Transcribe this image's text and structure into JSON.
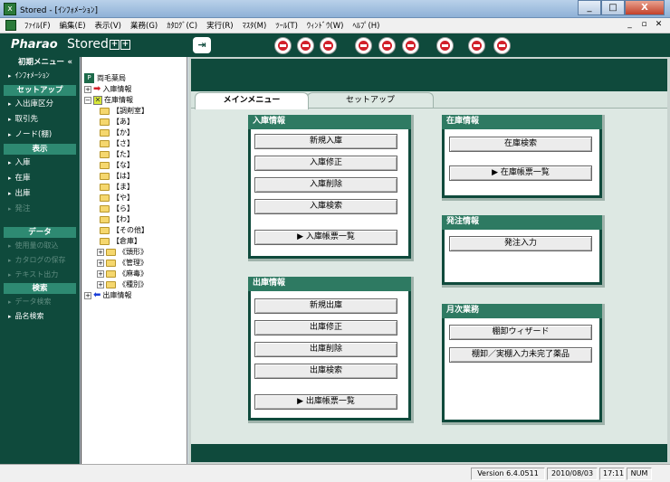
{
  "window": {
    "title": "Stored - [ｲﾝﾌｫﾒｰｼｮﾝ]",
    "min": "_",
    "max": "□",
    "close": "X"
  },
  "menu": [
    "ﾌｧｲﾙ(F)",
    "編集(E)",
    "表示(V)",
    "業務(G)",
    "ｶﾀﾛｸﾞ(C)",
    "実行(R)",
    "ﾏｽﾀ(M)",
    "ﾂｰﾙ(T)",
    "ｳｨﾝﾄﾞｳ(W)",
    "ﾍﾙﾌﾟ(H)"
  ],
  "mdi": {
    "min": "_",
    "restore": "▫",
    "close": "✕"
  },
  "toolbar": {
    "logo": "Pharao",
    "product": "Stored",
    "plus1": "+",
    "plus2": "+",
    "exit": "⇥"
  },
  "sidebar": {
    "initial_menu": "初期メニュー",
    "collapse": "«",
    "info": "ｲﾝﾌｫﾒｰｼｮﾝ",
    "setup_header": "セットアップ",
    "setup_items": [
      "入出庫区分",
      "取引先",
      "ノード(棚)"
    ],
    "display_header": "表示",
    "display_items": [
      "入庫",
      "在庫",
      "出庫",
      "発注"
    ],
    "data_header": "データ",
    "data_items": [
      "使用量の取込",
      "カタログの保存",
      "テキスト出力"
    ],
    "search_header": "検索",
    "search_items": [
      "データ検索",
      "品名検索"
    ]
  },
  "tree": {
    "root": "両毛薬局",
    "nyuko": "入庫情報",
    "zaiko": "在庫情報",
    "folders": [
      "【調剤室】",
      "【あ】",
      "【か】",
      "【さ】",
      "【た】",
      "【な】",
      "【は】",
      "【ま】",
      "【や】",
      "【ら】",
      "【わ】",
      "【その他】",
      "【倉庫】"
    ],
    "subfolders": [
      "《頭形》",
      "《管理》",
      "《麻毒》",
      "《種別》"
    ],
    "shukko": "出庫情報"
  },
  "tabs": {
    "main": "メインメニュー",
    "setup": "セットアップ"
  },
  "panels": {
    "nyuko": {
      "title": "入庫情報",
      "buttons": [
        "新規入庫",
        "入庫修正",
        "入庫削除",
        "入庫検索"
      ],
      "list": "▶ 入庫帳票一覧"
    },
    "shukko": {
      "title": "出庫情報",
      "buttons": [
        "新規出庫",
        "出庫修正",
        "出庫削除",
        "出庫検索"
      ],
      "list": "▶ 出庫帳票一覧"
    },
    "zaiko": {
      "title": "在庫情報",
      "buttons": [
        "在庫検索"
      ],
      "list": "▶ 在庫帳票一覧"
    },
    "hacchu": {
      "title": "発注情報",
      "buttons": [
        "発注入力"
      ]
    },
    "getsuji": {
      "title": "月次業務",
      "buttons": [
        "棚卸ウィザード",
        "棚卸／実棚入力未完了薬品"
      ]
    }
  },
  "status": {
    "version": "Version 6.4.0511",
    "date": "2010/08/03",
    "time": "17:11",
    "num": "NUM"
  }
}
